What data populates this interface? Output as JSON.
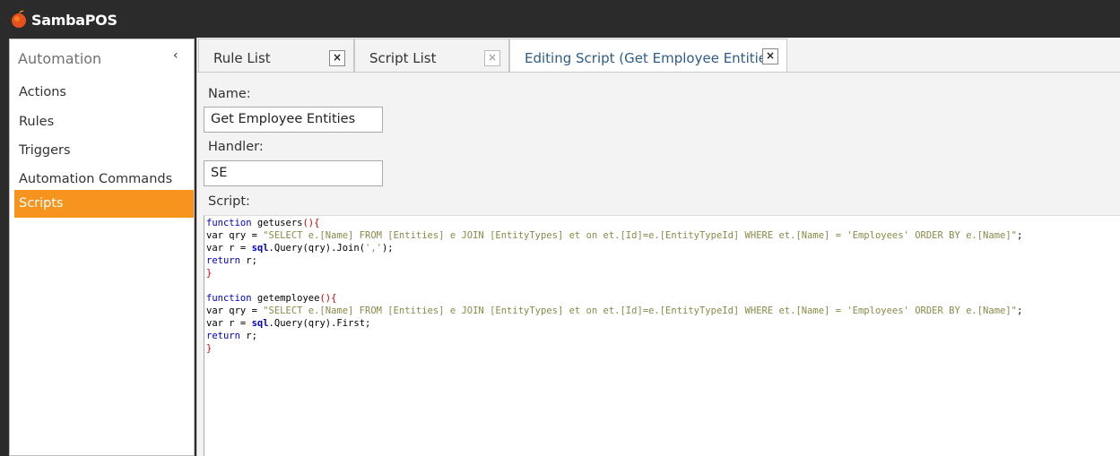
{
  "app": {
    "title": "SambaPOS",
    "logo_icon": "sambapos-fruit-logo",
    "accent": "#f7941d"
  },
  "sidebar": {
    "header": "Automation",
    "collapse_glyph": "‹",
    "items": [
      {
        "label": "Actions",
        "active": false
      },
      {
        "label": "Rules",
        "active": false
      },
      {
        "label": "Triggers",
        "active": false
      },
      {
        "label": "Automation Commands",
        "active": false
      },
      {
        "label": "Scripts",
        "active": true
      }
    ]
  },
  "tabs": [
    {
      "label": "Rule List",
      "close": "×",
      "active": false
    },
    {
      "label": "Script List",
      "close": "×",
      "active": false
    },
    {
      "label": "Editing Script (Get Employee Entities)",
      "close": "×",
      "active": true
    }
  ],
  "form": {
    "name_label": "Name:",
    "name_value": "Get Employee Entities",
    "handler_label": "Handler:",
    "handler_value": "SE",
    "script_label": "Script:"
  },
  "script": {
    "fn1_kw": "function",
    "fn1_name": " getusers",
    "fn1_open": "(){",
    "fn1_qry_a": "var qry = ",
    "fn1_qry_str": "\"SELECT e.[Name] FROM [Entities] e JOIN [EntityTypes] et on et.[Id]=e.[EntityTypeId] WHERE et.[Name] = 'Employees' ORDER BY e.[Name]\"",
    "fn1_qry_end": ";",
    "fn1_r_a": "var r = ",
    "fn1_r_obj": "sql",
    "fn1_r_b": ".Query(qry).Join(",
    "fn1_r_str": "','",
    "fn1_r_c": ");",
    "fn1_ret_kw": "return",
    "fn1_ret_rest": " r;",
    "fn1_close": "}",
    "fn2_kw": "function",
    "fn2_name": " getemployee",
    "fn2_open": "(){",
    "fn2_qry_a": "var qry = ",
    "fn2_qry_str": "\"SELECT e.[Name] FROM [Entities] e JOIN [EntityTypes] et on et.[Id]=e.[EntityTypeId] WHERE et.[Name] = 'Employees' ORDER BY e.[Name]\"",
    "fn2_qry_end": ";",
    "fn2_r_a": "var r = ",
    "fn2_r_obj": "sql",
    "fn2_r_b": ".Query(qry).First;",
    "fn2_ret_kw": "return",
    "fn2_ret_rest": " r;",
    "fn2_close": "}"
  }
}
